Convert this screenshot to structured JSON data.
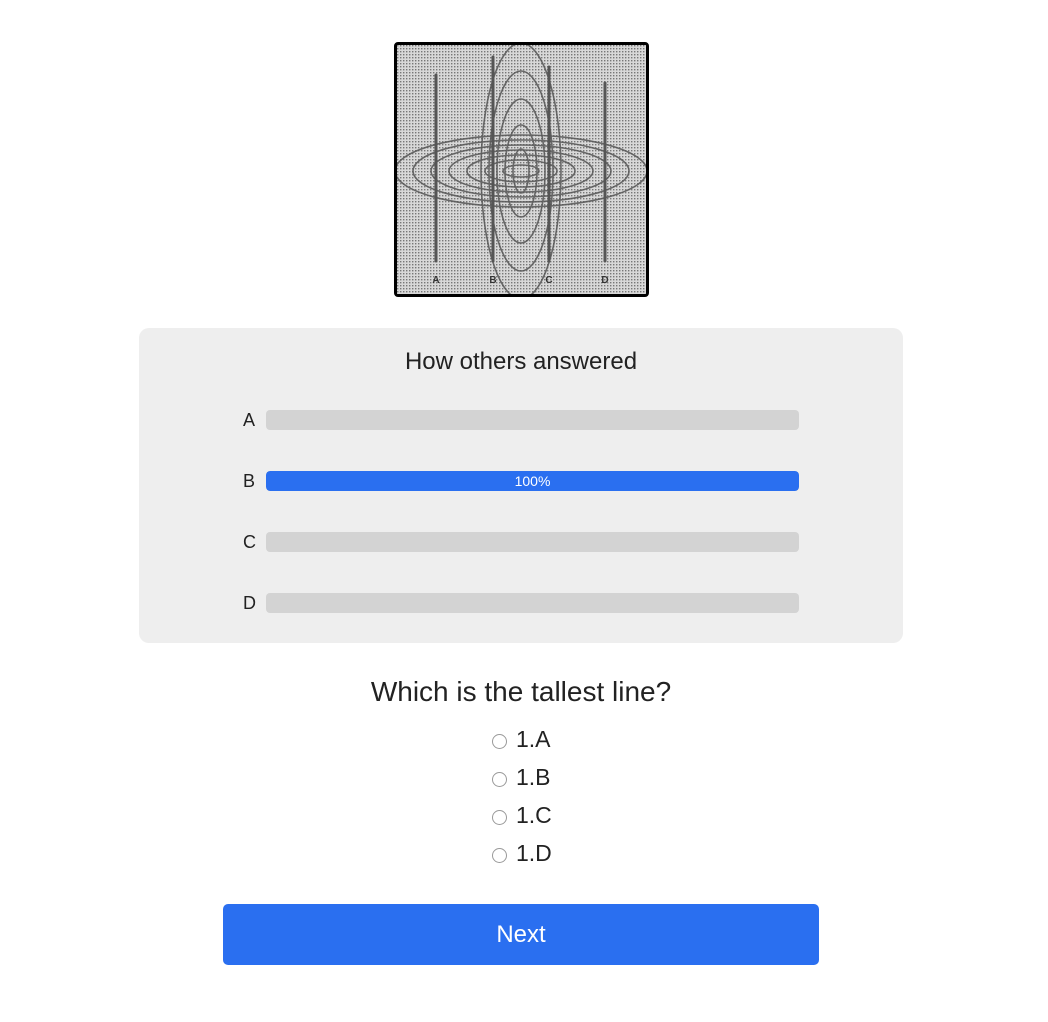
{
  "illusion": {
    "line_labels": [
      "A",
      "B",
      "C",
      "D"
    ]
  },
  "results": {
    "title": "How others answered",
    "options": [
      {
        "label": "A",
        "percent": 0,
        "percent_text": ""
      },
      {
        "label": "B",
        "percent": 100,
        "percent_text": "100%"
      },
      {
        "label": "C",
        "percent": 0,
        "percent_text": ""
      },
      {
        "label": "D",
        "percent": 0,
        "percent_text": ""
      }
    ],
    "colors": {
      "fill": "#2a6ff0",
      "track": "#d3d3d3"
    }
  },
  "question": {
    "text": "Which is the tallest line?",
    "options": [
      "1.A",
      "1.B",
      "1.C",
      "1.D"
    ]
  },
  "next_button": {
    "label": "Next",
    "color": "#2a6ff0"
  }
}
